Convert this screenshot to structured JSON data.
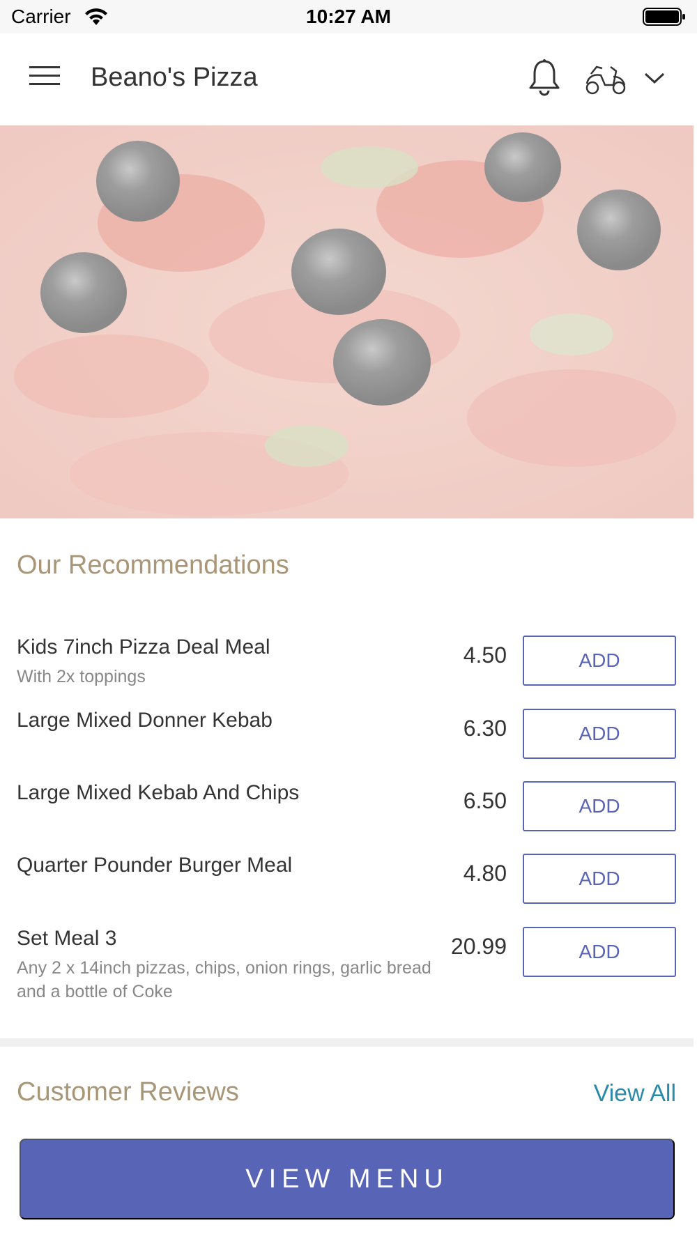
{
  "status_bar": {
    "carrier": "Carrier",
    "time": "10:27 AM"
  },
  "header": {
    "title": "Beano's Pizza",
    "icons": [
      "menu-icon",
      "bell-icon",
      "scooter-icon",
      "chevron-down-icon"
    ]
  },
  "hero": {
    "image": "pizza-banner"
  },
  "recommendations": {
    "title": "Our Recommendations",
    "items": [
      {
        "name": "Kids 7inch Pizza Deal Meal",
        "description": "With 2x toppings",
        "price": "4.50",
        "add_label": "ADD"
      },
      {
        "name": "Large Mixed Donner Kebab",
        "description": "",
        "price": "6.30",
        "add_label": "ADD"
      },
      {
        "name": "Large Mixed Kebab And Chips",
        "description": "",
        "price": "6.50",
        "add_label": "ADD"
      },
      {
        "name": "Quarter Pounder Burger Meal",
        "description": "",
        "price": "4.80",
        "add_label": "ADD"
      },
      {
        "name": "Set Meal 3",
        "description": "Any 2 x 14inch pizzas, chips, onion rings, garlic bread and a bottle of Coke",
        "price": "20.99",
        "add_label": "ADD"
      }
    ]
  },
  "reviews": {
    "title": "Customer Reviews",
    "view_all_label": "View All"
  },
  "footer": {
    "view_menu_label": "VIEW MENU"
  },
  "colors": {
    "accent": "#5864b6",
    "section_title": "#a89677",
    "link": "#2a8aaa"
  }
}
